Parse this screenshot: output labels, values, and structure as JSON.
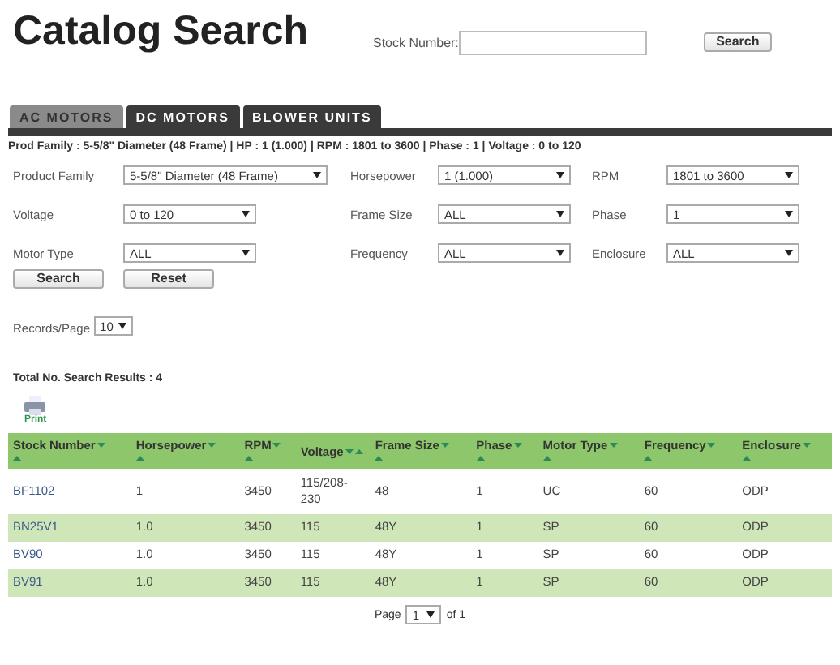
{
  "title": "Catalog Search",
  "stock_search": {
    "label": "Stock Number:",
    "button": "Search"
  },
  "tabs": [
    {
      "label": "AC MOTORS",
      "selected": true
    },
    {
      "label": "DC MOTORS",
      "selected": false
    },
    {
      "label": "BLOWER UNITS",
      "selected": false
    }
  ],
  "breadcrumb": "Prod Family : 5-5/8\" Diameter (48 Frame) | HP : 1 (1.000) | RPM : 1801 to 3600 | Phase : 1 | Voltage : 0 to 120",
  "filters": [
    {
      "label": "Product Family",
      "value": "5-5/8\" Diameter (48 Frame)"
    },
    {
      "label": "Horsepower",
      "value": "1 (1.000)"
    },
    {
      "label": "RPM",
      "value": "1801 to 3600"
    },
    {
      "label": "Voltage",
      "value": "0 to 120"
    },
    {
      "label": "Frame Size",
      "value": "ALL"
    },
    {
      "label": "Phase",
      "value": "1"
    },
    {
      "label": "Motor Type",
      "value": "ALL"
    },
    {
      "label": "Frequency",
      "value": "ALL"
    },
    {
      "label": "Enclosure",
      "value": "ALL"
    }
  ],
  "buttons": [
    "Search",
    "Reset"
  ],
  "records_per_page": {
    "label": "Records/Page",
    "value": "10"
  },
  "total_results": "Total No. Search Results : 4",
  "print": "Print",
  "table": {
    "columns": [
      {
        "label": "Stock Number",
        "sorted": false
      },
      {
        "label": "Horsepower",
        "sorted": false
      },
      {
        "label": "RPM",
        "sorted": false
      },
      {
        "label": "Voltage",
        "sorted": true
      },
      {
        "label": "Frame Size",
        "sorted": false
      },
      {
        "label": "Phase",
        "sorted": false
      },
      {
        "label": "Motor Type",
        "sorted": false
      },
      {
        "label": "Frequency",
        "sorted": false
      },
      {
        "label": "Enclosure",
        "sorted": false
      }
    ],
    "rows": [
      [
        "BF1102",
        "1",
        "3450",
        "115/208-230",
        "48",
        "1",
        "UC",
        "60",
        "ODP"
      ],
      [
        "BN25V1",
        "1.0",
        "3450",
        "115",
        "48Y",
        "1",
        "SP",
        "60",
        "ODP"
      ],
      [
        "BV90",
        "1.0",
        "3450",
        "115",
        "48Y",
        "1",
        "SP",
        "60",
        "ODP"
      ],
      [
        "BV91",
        "1.0",
        "3450",
        "115",
        "48Y",
        "1",
        "SP",
        "60",
        "ODP"
      ]
    ]
  },
  "pager": {
    "label": "Page",
    "value": "1",
    "total": "of 1"
  }
}
